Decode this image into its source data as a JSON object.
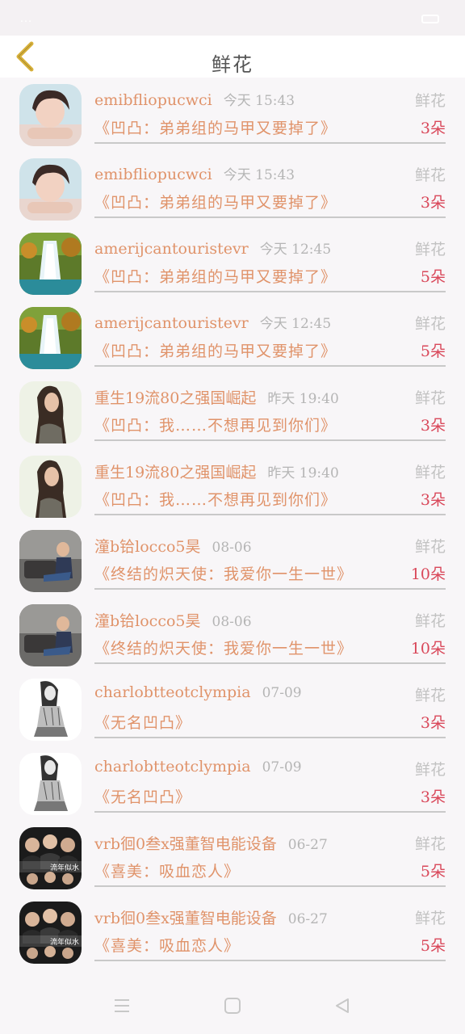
{
  "status_bar": {
    "left_text": "…"
  },
  "header": {
    "title": "鲜花"
  },
  "colors": {
    "accent": "#e0936a",
    "count": "#d9485a",
    "muted": "#b5b5b5",
    "divider": "#c9c9c9",
    "back_icon": "#d8b13b"
  },
  "rows": [
    {
      "username": "emibfliopucwci",
      "time": "今天 15:43",
      "gift": "鲜花",
      "book": "《凹凸：弟弟组的马甲又要掉了》",
      "count": "3朵",
      "avatar": "girl-photo"
    },
    {
      "username": "emibfliopucwci",
      "time": "今天 15:43",
      "gift": "鲜花",
      "book": "《凹凸：弟弟组的马甲又要掉了》",
      "count": "3朵",
      "avatar": "girl-photo"
    },
    {
      "username": "amerijcantouristevr",
      "time": "今天 12:45",
      "gift": "鲜花",
      "book": "《凹凸：弟弟组的马甲又要掉了》",
      "count": "5朵",
      "avatar": "waterfall-photo"
    },
    {
      "username": "amerijcantouristevr",
      "time": "今天 12:45",
      "gift": "鲜花",
      "book": "《凹凸：弟弟组的马甲又要掉了》",
      "count": "5朵",
      "avatar": "waterfall-photo"
    },
    {
      "username": "重生19流80之强国崛起",
      "time": "昨天 19:40",
      "gift": "鲜花",
      "book": "《凹凸：我……不想再见到你们》",
      "count": "3朵",
      "avatar": "woman-photo"
    },
    {
      "username": "重生19流80之强国崛起",
      "time": "昨天 19:40",
      "gift": "鲜花",
      "book": "《凹凸：我……不想再见到你们》",
      "count": "3朵",
      "avatar": "woman-photo"
    },
    {
      "username": "潼b铪locco5昊",
      "time": "08-06",
      "gift": "鲜花",
      "book": "《终结的炽天使：我爱你一生一世》",
      "count": "10朵",
      "avatar": "man-photo"
    },
    {
      "username": "潼b铪locco5昊",
      "time": "08-06",
      "gift": "鲜花",
      "book": "《终结的炽天使：我爱你一生一世》",
      "count": "10朵",
      "avatar": "man-photo"
    },
    {
      "username": "charlobtteotclympia",
      "time": "07-09",
      "gift": "鲜花",
      "book": "《无名凹凸》",
      "count": "3朵",
      "avatar": "sketch-photo"
    },
    {
      "username": "charlobtteotclympia",
      "time": "07-09",
      "gift": "鲜花",
      "book": "《无名凹凸》",
      "count": "3朵",
      "avatar": "sketch-photo"
    },
    {
      "username": "vrb徊0叁x强董智电能设备",
      "time": "06-27",
      "gift": "鲜花",
      "book": "《喜美：吸血恋人》",
      "count": "5朵",
      "avatar": "group-photo",
      "avatar_caption": "流年似水"
    },
    {
      "username": "vrb徊0叁x强董智电能设备",
      "time": "06-27",
      "gift": "鲜花",
      "book": "《喜美：吸血恋人》",
      "count": "5朵",
      "avatar": "group-photo",
      "avatar_caption": "流年似水"
    }
  ],
  "nav": {
    "icons": [
      "menu-icon",
      "home-square-icon",
      "back-triangle-icon"
    ]
  }
}
